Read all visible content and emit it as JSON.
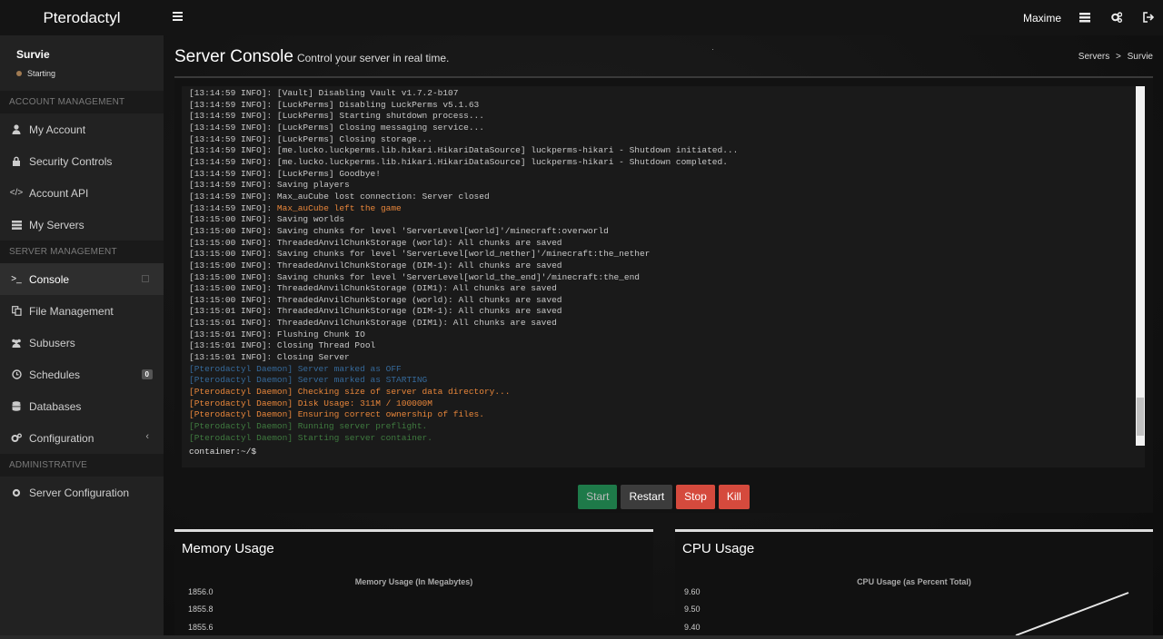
{
  "app": {
    "brand": "Pterodactyl"
  },
  "navbar": {
    "user": "Maxime",
    "icons": [
      "menu-icon",
      "server-list-icon",
      "cogs-icon",
      "sign-out-icon"
    ]
  },
  "server": {
    "name": "Survie",
    "status": "Starting",
    "status_color": "#a07a52"
  },
  "sidebar": {
    "account_header": "ACCOUNT MANAGEMENT",
    "account_items": [
      {
        "label": "My Account",
        "icon": "user-icon"
      },
      {
        "label": "Security Controls",
        "icon": "lock-icon"
      },
      {
        "label": "Account API",
        "icon": "code-icon"
      },
      {
        "label": "My Servers",
        "icon": "server-icon"
      }
    ],
    "server_header": "SERVER MANAGEMENT",
    "server_items": [
      {
        "label": "Console",
        "icon": "terminal-icon"
      },
      {
        "label": "File Management",
        "icon": "files-icon"
      },
      {
        "label": "Subusers",
        "icon": "users-icon"
      },
      {
        "label": "Schedules",
        "icon": "clock-icon",
        "badge": "0"
      },
      {
        "label": "Databases",
        "icon": "database-icon"
      },
      {
        "label": "Configuration",
        "icon": "cogs-icon"
      }
    ],
    "admin_header": "ADMINISTRATIVE",
    "admin_items": [
      {
        "label": "Server Configuration",
        "icon": "gear-icon"
      }
    ]
  },
  "page": {
    "title": "Server Console",
    "subtitle": "Control your server in real time.",
    "breadcrumb": [
      "Servers",
      ">",
      "Survie"
    ]
  },
  "console": {
    "lines": [
      {
        "text": "[13:14:59 INFO]: [Vault] Disabling Vault v1.7.2-b107",
        "color": "default"
      },
      {
        "text": "[13:14:59 INFO]: [LuckPerms] Disabling LuckPerms v5.1.63",
        "color": "default"
      },
      {
        "text": "[13:14:59 INFO]: [LuckPerms] Starting shutdown process...",
        "color": "default"
      },
      {
        "text": "[13:14:59 INFO]: [LuckPerms] Closing messaging service...",
        "color": "default"
      },
      {
        "text": "[13:14:59 INFO]: [LuckPerms] Closing storage...",
        "color": "default"
      },
      {
        "text": "[13:14:59 INFO]: [me.lucko.luckperms.lib.hikari.HikariDataSource] luckperms-hikari - Shutdown initiated...",
        "color": "default"
      },
      {
        "text": "[13:14:59 INFO]: [me.lucko.luckperms.lib.hikari.HikariDataSource] luckperms-hikari - Shutdown completed.",
        "color": "default"
      },
      {
        "text": "[13:14:59 INFO]: [LuckPerms] Goodbye!",
        "color": "default"
      },
      {
        "text": "[13:14:59 INFO]: Saving players",
        "color": "default"
      },
      {
        "text": "[13:14:59 INFO]: Max_auCube lost connection: Server closed",
        "color": "default"
      },
      {
        "text": "[13:14:59 INFO]: ",
        "color": "default",
        "tail": "Max_auCube left the game"
      },
      {
        "text": "[13:15:00 INFO]: Saving worlds",
        "color": "default"
      },
      {
        "text": "[13:15:00 INFO]: Saving chunks for level 'ServerLevel[world]'/minecraft:overworld",
        "color": "default"
      },
      {
        "text": "[13:15:00 INFO]: ThreadedAnvilChunkStorage (world): All chunks are saved",
        "color": "default"
      },
      {
        "text": "[13:15:00 INFO]: Saving chunks for level 'ServerLevel[world_nether]'/minecraft:the_nether",
        "color": "default"
      },
      {
        "text": "[13:15:00 INFO]: ThreadedAnvilChunkStorage (DIM-1): All chunks are saved",
        "color": "default"
      },
      {
        "text": "[13:15:00 INFO]: Saving chunks for level 'ServerLevel[world_the_end]'/minecraft:the_end",
        "color": "default"
      },
      {
        "text": "[13:15:00 INFO]: ThreadedAnvilChunkStorage (DIM1): All chunks are saved",
        "color": "default"
      },
      {
        "text": "[13:15:00 INFO]: ThreadedAnvilChunkStorage (world): All chunks are saved",
        "color": "default"
      },
      {
        "text": "[13:15:01 INFO]: ThreadedAnvilChunkStorage (DIM-1): All chunks are saved",
        "color": "default"
      },
      {
        "text": "[13:15:01 INFO]: ThreadedAnvilChunkStorage (DIM1): All chunks are saved",
        "color": "default"
      },
      {
        "text": "[13:15:01 INFO]: Flushing Chunk IO",
        "color": "default"
      },
      {
        "text": "[13:15:01 INFO]: Closing Thread Pool",
        "color": "default"
      },
      {
        "text": "[13:15:01 INFO]: Closing Server",
        "color": "default"
      },
      {
        "text": "[Pterodactyl Daemon] Server marked as OFF",
        "color": "blue"
      },
      {
        "text": "[Pterodactyl Daemon] Server marked as STARTING",
        "color": "blue"
      },
      {
        "text": "[Pterodactyl Daemon] Checking size of server data directory...",
        "color": "orange"
      },
      {
        "text": "[Pterodactyl Daemon] Disk Usage: 311M / 100000M",
        "color": "orange"
      },
      {
        "text": "[Pterodactyl Daemon] Ensuring correct ownership of files.",
        "color": "orange"
      },
      {
        "text": "[Pterodactyl Daemon] Running server preflight.",
        "color": "green"
      },
      {
        "text": "[Pterodactyl Daemon] Starting server container.",
        "color": "green"
      }
    ],
    "prompt": "container:~/$"
  },
  "power": {
    "start": "Start",
    "restart": "Restart",
    "stop": "Stop",
    "kill": "Kill"
  },
  "memory_panel": {
    "title": "Memory Usage",
    "chart_title": "Memory Usage (In Megabytes)",
    "ticks": [
      "1856.0",
      "1855.8",
      "1855.6"
    ]
  },
  "cpu_panel": {
    "title": "CPU Usage",
    "chart_title": "CPU Usage (as Percent Total)",
    "ticks": [
      "9.60",
      "9.50",
      "9.40"
    ]
  },
  "chart_data": [
    {
      "type": "line",
      "title": "Memory Usage (In Megabytes)",
      "xlabel": "",
      "ylabel": "",
      "y_ticks": [
        1856.0,
        1855.8,
        1855.6
      ],
      "series": [
        {
          "values": []
        }
      ]
    },
    {
      "type": "line",
      "title": "CPU Usage (as Percent Total)",
      "xlabel": "",
      "ylabel": "",
      "y_ticks": [
        9.6,
        9.5,
        9.4
      ],
      "series": [
        {
          "values": [
            9.4,
            9.6
          ]
        }
      ]
    }
  ]
}
